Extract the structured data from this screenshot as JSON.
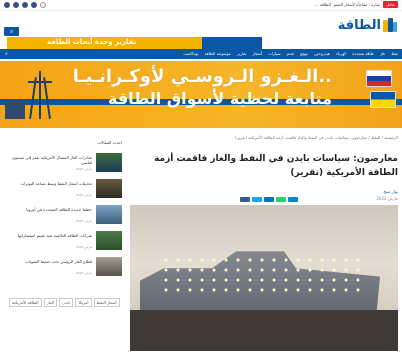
{
  "ticker": {
    "badge": "عاجل",
    "text": "سارة : مفاجأة لأسعار التسو",
    "extra": "... الطاقة"
  },
  "logo": {
    "wordmark": "الطاقة"
  },
  "banner": {
    "text": "تقارير وحدة أبحاث الطاقة"
  },
  "nav": {
    "items": [
      "نفط",
      "غاز",
      "طاقة متجددة",
      "كهرباء",
      "هيدروجين",
      "نووي",
      "فحم",
      "سيارات",
      "أسعار",
      "تقارير",
      "موسوعة الطاقة",
      "بودكاست"
    ]
  },
  "hero": {
    "headline1": "الـغـزو الـروسـي لأوكـرانـيـا..",
    "headline2": "متابعة لحظية لأسواق الطاقة"
  },
  "article": {
    "breadcrumb": "الرئيسية / النفط / معارضون: سياسات بايدن في النفط والغاز فاقمت أزمة الطاقة الأمريكية (تقرير)",
    "title": "معارضون: سياسات بايدن في النفط والغاز فاقمت أزمة الطاقة الأمريكية (تقرير)",
    "author": "نوار صبح",
    "date": "2022 مارس"
  },
  "sidebar": {
    "heading": "أحدث المقالات",
    "cards": [
      {
        "text": "صادرات الغاز المسال الأمريكية تقفز إلى مستوى قياسي",
        "date": "2022 مارس"
      },
      {
        "text": "تحديثات أسعار النفط وسط تصاعد التوترات",
        "date": "2022 مارس"
      },
      {
        "text": "خطط جديدة للطاقة المتجددة في أوروبا",
        "date": "2022 مارس"
      },
      {
        "text": "شركات الطاقة العالمية تعيد تقييم استثماراتها",
        "date": "2022 مارس"
      },
      {
        "text": "قطاع الغاز الروسي تحت ضغط العقوبات",
        "date": "2022 مارس"
      }
    ]
  },
  "tags": [
    "أسعار النفط",
    "أمريكا",
    "بايدن",
    "الغاز",
    "الطاقة الأمريكية"
  ]
}
